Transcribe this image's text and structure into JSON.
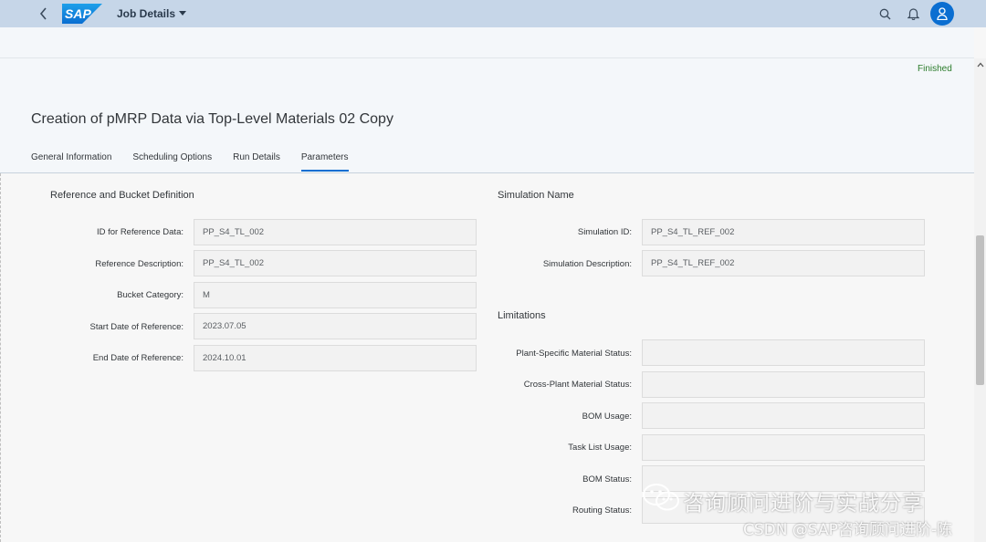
{
  "shell": {
    "logo_text": "SAP",
    "app_title": "Job Details"
  },
  "header": {
    "status": "Finished",
    "title": "Creation of pMRP Data via Top-Level Materials 02 Copy"
  },
  "tabs": [
    {
      "label": "General Information"
    },
    {
      "label": "Scheduling Options"
    },
    {
      "label": "Run Details"
    },
    {
      "label": "Parameters",
      "active": true
    }
  ],
  "reference": {
    "title": "Reference and Bucket Definition",
    "fields": [
      {
        "label": "ID for Reference Data:",
        "value": "PP_S4_TL_002"
      },
      {
        "label": "Reference Description:",
        "value": "PP_S4_TL_002"
      },
      {
        "label": "Bucket Category:",
        "value": "M"
      },
      {
        "label": "Start Date of Reference:",
        "value": "2023.07.05"
      },
      {
        "label": "End Date of Reference:",
        "value": "2024.10.01"
      }
    ]
  },
  "simulation": {
    "title": "Simulation Name",
    "fields": [
      {
        "label": "Simulation ID:",
        "value": "PP_S4_TL_REF_002"
      },
      {
        "label": "Simulation Description:",
        "value": "PP_S4_TL_REF_002"
      }
    ]
  },
  "limitations": {
    "title": "Limitations",
    "fields": [
      {
        "label": "Plant-Specific Material Status:",
        "value": ""
      },
      {
        "label": "Cross-Plant Material Status:",
        "value": ""
      },
      {
        "label": "BOM Usage:",
        "value": ""
      },
      {
        "label": "Task List Usage:",
        "value": ""
      },
      {
        "label": "BOM Status:",
        "value": ""
      },
      {
        "label": "Routing Status:",
        "value": ""
      }
    ]
  },
  "watermark": {
    "line1": "咨询顾问进阶与实战分享",
    "line2": "CSDN @SAP咨询顾问进阶-陈"
  },
  "icons": {
    "back": "back-icon",
    "dropdown": "chevron-down-icon",
    "search": "search-icon",
    "notifications": "bell-icon",
    "user": "user-icon"
  },
  "colors": {
    "shellbar": "#c6d6e8",
    "accent": "#0a6ed1",
    "status_success": "#2b7c2b"
  }
}
